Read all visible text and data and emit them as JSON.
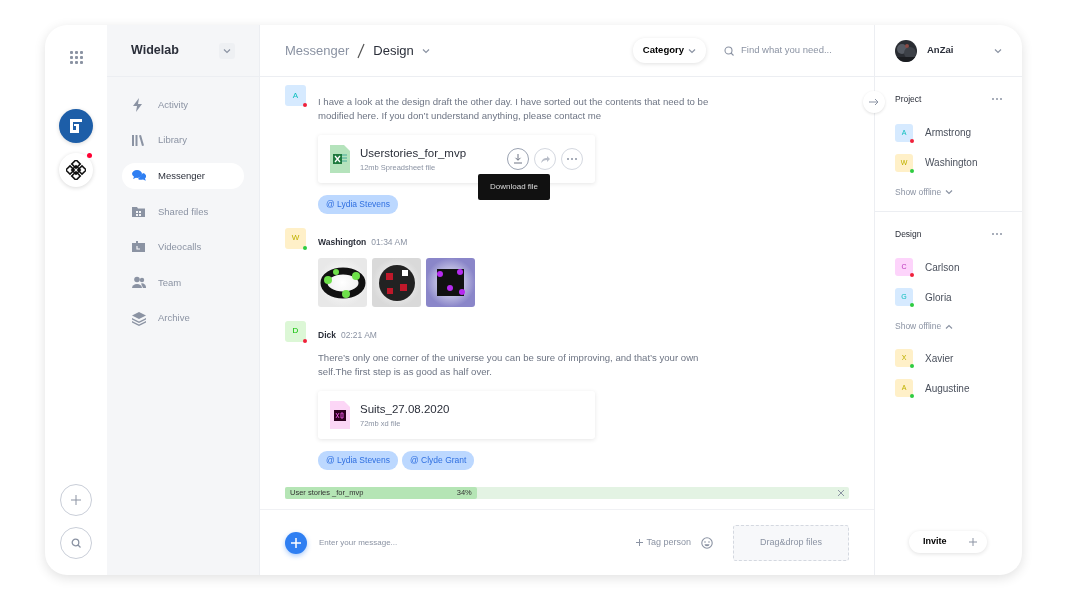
{
  "rail": {
    "workspaces": [
      {
        "kind": "badge-logo",
        "unread": false
      },
      {
        "kind": "pattern-logo",
        "unread": true
      }
    ]
  },
  "sidebar": {
    "title": "Widelab",
    "items": [
      {
        "label": "Activity",
        "selected": false
      },
      {
        "label": "Library",
        "selected": false
      },
      {
        "label": "Messenger",
        "selected": true
      },
      {
        "label": "Shared files",
        "selected": false
      },
      {
        "label": "Videocalls",
        "selected": false
      },
      {
        "label": "Team",
        "selected": false
      },
      {
        "label": "Archive",
        "selected": false
      }
    ]
  },
  "header": {
    "breadcrumb": [
      "Messenger",
      "Design"
    ],
    "category": "Category",
    "search": {
      "placeholder": "Find what you need..."
    },
    "user": "AnZai"
  },
  "messages": [
    {
      "avatar": "A",
      "color": "#d6eaff",
      "online": false,
      "text": "I have a look at the design draft the other day. I have sorted out the contents that need to be modified here. If you don’t understand anything, please contact me",
      "file": {
        "kind": "spreadsheet",
        "name": "Userstories_for_mvp",
        "meta": "12mb Spreadsheet file",
        "tooltip": "Download file"
      },
      "mentions": [
        "@ Lydia Stevens"
      ]
    },
    {
      "avatar": "W",
      "color": "#fff0c8",
      "online": true,
      "author": "Washington",
      "time": "01:34 AM"
    },
    {
      "avatar": "D",
      "color": "#dcf7d6",
      "online": false,
      "author": "Dick",
      "time": "02:21 AM",
      "text": "There’s only one corner of the universe you can be sure of improving, and that’s your own self.The first step is as good as half over.",
      "file": {
        "kind": "xd",
        "name": "Suits_27.08.2020",
        "meta": "72mb xd file"
      },
      "mentions": [
        "@ Lydia Stevens",
        "@ Clyde Grant"
      ]
    }
  ],
  "upload": {
    "name": "User stories _for_mvp",
    "reading": "34%",
    "level": 0.34
  },
  "composer": {
    "placeholder": "Enter your message...",
    "tag": "Tag person",
    "drop": "Drag&drop files"
  },
  "groups": [
    {
      "title": "Project",
      "members": [
        {
          "avatar": "A",
          "name": "Armstrong",
          "color": "#d6eaff",
          "online": false
        },
        {
          "avatar": "W",
          "name": "Washington",
          "color": "#fff0c8",
          "online": true
        }
      ],
      "toggle": "Show offline",
      "expanded": false
    },
    {
      "title": "Design",
      "members": [
        {
          "avatar": "C",
          "name": "Carlson",
          "color": "#fdd4fb",
          "online": false
        },
        {
          "avatar": "G",
          "name": "Gloria",
          "color": "#d6eaff",
          "online": true
        }
      ],
      "toggle": "Show offline",
      "expanded": true,
      "offline": [
        {
          "avatar": "X",
          "name": "Xavier",
          "color": "#fff0c8",
          "online": true
        },
        {
          "avatar": "A",
          "name": "Augustine",
          "color": "#fff0c8",
          "online": true
        }
      ]
    }
  ],
  "invite": "Invite"
}
